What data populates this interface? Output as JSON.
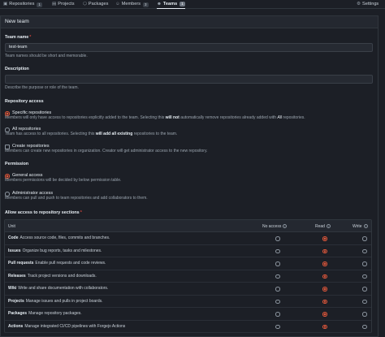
{
  "tabs": [
    {
      "label": "Repositories",
      "count": "1",
      "icon": "repo-icon"
    },
    {
      "label": "Projects",
      "icon": "project-icon"
    },
    {
      "label": "Packages",
      "icon": "package-icon"
    },
    {
      "label": "Members",
      "count": "3",
      "icon": "person-icon"
    },
    {
      "label": "Teams",
      "count": "1",
      "icon": "people-icon"
    },
    {
      "label": "Settings",
      "icon": "gear-icon"
    }
  ],
  "form": {
    "title": "New team",
    "team_name_label": "Team name",
    "team_name_value": "test-team",
    "team_name_help": "Team names should be short and memorable.",
    "description_label": "Description",
    "description_value": "",
    "description_help": "Describe the purpose or role of the team.",
    "repo_access_label": "Repository access",
    "specific_title": "Specific repositories",
    "specific_help_pre": "Members will only have access to repositories explicitly added to the team. Selecting this ",
    "specific_help_bold": "will not",
    "specific_help_post": " automatically remove repositories already added with ",
    "specific_help_italic": "All",
    "specific_help_end": " repositories.",
    "all_title": "All repositories",
    "all_help_pre": "Team has access to all repositories. Selecting this ",
    "all_help_bold": "will add all existing",
    "all_help_post": " repositories to the team.",
    "create_title": "Create repositories",
    "create_help": "Members can create new repositories in organization. Creator will get administrator access to the new repository.",
    "permission_label": "Permission",
    "general_title": "General access",
    "general_help": "Members permissions will be decided by below permission table.",
    "admin_title": "Administrator access",
    "admin_help": "Members can pull and push to team repositories and add collaborators to them.",
    "units_label": "Allow access to repository sections"
  },
  "table": {
    "headers": {
      "unit": "Unit",
      "none": "No access",
      "read": "Read",
      "write": "Write"
    },
    "rows": [
      {
        "name": "Code",
        "desc": "Access source code, files, commits and branches.",
        "selected": "read"
      },
      {
        "name": "Issues",
        "desc": "Organize bug reports, tasks and milestones.",
        "selected": "read"
      },
      {
        "name": "Pull requests",
        "desc": "Enable pull requests and code reviews.",
        "selected": "read"
      },
      {
        "name": "Releases",
        "desc": "Track project versions and downloads.",
        "selected": "read"
      },
      {
        "name": "Wiki",
        "desc": "Write and share documentation with collaborators.",
        "selected": "read"
      },
      {
        "name": "Projects",
        "desc": "Manage issues and pulls in project boards.",
        "selected": "read"
      },
      {
        "name": "Packages",
        "desc": "Manage repository packages.",
        "selected": "read"
      },
      {
        "name": "Actions",
        "desc": "Manage integrated CI/CD pipelines with Forgejo Actions",
        "selected": "read"
      }
    ]
  },
  "colors": {
    "accent": "#e0573a",
    "background": "#1c1f26",
    "panel_header": "#242830"
  }
}
